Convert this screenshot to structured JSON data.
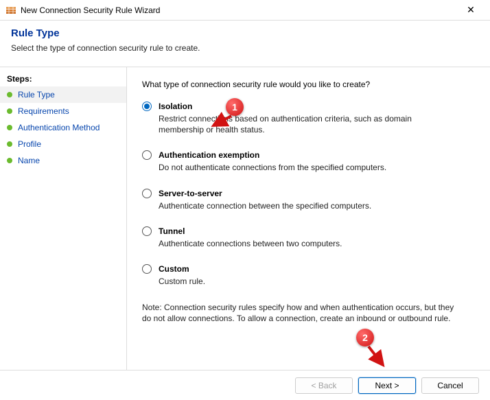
{
  "window": {
    "title": "New Connection Security Rule Wizard",
    "close_label": "✕"
  },
  "header": {
    "title": "Rule Type",
    "subtitle": "Select the type of connection security rule to create."
  },
  "sidebar": {
    "steps_label": "Steps:",
    "items": [
      {
        "label": "Rule Type",
        "current": true
      },
      {
        "label": "Requirements",
        "current": false
      },
      {
        "label": "Authentication Method",
        "current": false
      },
      {
        "label": "Profile",
        "current": false
      },
      {
        "label": "Name",
        "current": false
      }
    ]
  },
  "main": {
    "question": "What type of connection security rule would you like to create?",
    "options": [
      {
        "key": "isolation",
        "label": "Isolation",
        "desc": "Restrict connections based on authentication criteria, such as domain membership or health status.",
        "selected": true
      },
      {
        "key": "auth-exemption",
        "label": "Authentication exemption",
        "desc": "Do not authenticate connections from the specified computers.",
        "selected": false
      },
      {
        "key": "server-to-server",
        "label": "Server-to-server",
        "desc": "Authenticate connection between the specified computers.",
        "selected": false
      },
      {
        "key": "tunnel",
        "label": "Tunnel",
        "desc": "Authenticate connections between two computers.",
        "selected": false
      },
      {
        "key": "custom",
        "label": "Custom",
        "desc": "Custom rule.",
        "selected": false
      }
    ],
    "note": "Note:  Connection security rules specify how and when authentication occurs, but they do not allow connections.  To allow a connection, create an inbound or outbound rule."
  },
  "footer": {
    "back": "< Back",
    "next": "Next >",
    "cancel": "Cancel"
  },
  "annotations": {
    "badge1": "1",
    "badge2": "2"
  }
}
